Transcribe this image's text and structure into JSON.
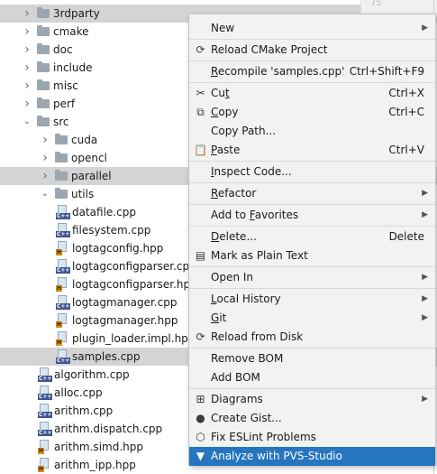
{
  "tree": {
    "scroll_hint": "75",
    "rows": [
      {
        "label": "3rdparty",
        "kind": "folder",
        "expand": "closed"
      },
      {
        "label": "cmake",
        "kind": "folder",
        "expand": "closed"
      },
      {
        "label": "doc",
        "kind": "folder",
        "expand": "closed"
      },
      {
        "label": "include",
        "kind": "folder",
        "expand": "closed"
      },
      {
        "label": "misc",
        "kind": "folder",
        "expand": "closed"
      },
      {
        "label": "perf",
        "kind": "folder",
        "expand": "closed"
      },
      {
        "label": "src",
        "kind": "folder",
        "expand": "open"
      },
      {
        "label": "cuda",
        "kind": "folder",
        "expand": "closed"
      },
      {
        "label": "opencl",
        "kind": "folder",
        "expand": "closed"
      },
      {
        "label": "parallel",
        "kind": "folder",
        "expand": "closed"
      },
      {
        "label": "utils",
        "kind": "folder",
        "expand": "open"
      },
      {
        "label": "datafile.cpp",
        "kind": "cpp",
        "tag": "C++"
      },
      {
        "label": "filesystem.cpp",
        "kind": "cpp",
        "tag": "C++"
      },
      {
        "label": "logtagconfig.hpp",
        "kind": "hpp",
        "tag": "H"
      },
      {
        "label": "logtagconfigparser.cp",
        "kind": "cpp",
        "tag": "C++"
      },
      {
        "label": "logtagconfigparser.hp",
        "kind": "hpp",
        "tag": "H"
      },
      {
        "label": "logtagmanager.cpp",
        "kind": "cpp",
        "tag": "C++"
      },
      {
        "label": "logtagmanager.hpp",
        "kind": "hpp",
        "tag": "H"
      },
      {
        "label": "plugin_loader.impl.hp",
        "kind": "hpp",
        "tag": "H"
      },
      {
        "label": "samples.cpp",
        "kind": "cpp",
        "tag": "C++"
      },
      {
        "label": "algorithm.cpp",
        "kind": "cpp",
        "tag": "C++"
      },
      {
        "label": "alloc.cpp",
        "kind": "cpp",
        "tag": "C++"
      },
      {
        "label": "arithm.cpp",
        "kind": "cpp",
        "tag": "C++"
      },
      {
        "label": "arithm.dispatch.cpp",
        "kind": "cpp",
        "tag": "C++"
      },
      {
        "label": "arithm.simd.hpp",
        "kind": "hpp",
        "tag": "H"
      },
      {
        "label": "arithm_ipp.hpp",
        "kind": "hpp",
        "tag": "H"
      }
    ]
  },
  "menu": {
    "items": [
      {
        "label": "New",
        "submenu": true
      },
      {
        "sep": true
      },
      {
        "label": "Reload CMake Project",
        "icon": "reload-cmake-icon",
        "glyph": "⟳"
      },
      {
        "sep": true
      },
      {
        "label": "Recompile 'samples.cpp'",
        "shortcut": "Ctrl+Shift+F9"
      },
      {
        "sep": true
      },
      {
        "label": "Cut",
        "icon": "cut-icon",
        "glyph": "✂",
        "shortcut": "Ctrl+X"
      },
      {
        "label": "Copy",
        "icon": "copy-icon",
        "glyph": "⧉",
        "shortcut": "Ctrl+C"
      },
      {
        "label": "Copy Path..."
      },
      {
        "label": "Paste",
        "icon": "paste-icon",
        "glyph": "📋",
        "shortcut": "Ctrl+V"
      },
      {
        "sep": true
      },
      {
        "label": "Inspect Code..."
      },
      {
        "sep": true
      },
      {
        "label": "Refactor",
        "submenu": true
      },
      {
        "sep": true
      },
      {
        "label": "Add to Favorites",
        "submenu": true
      },
      {
        "sep": true
      },
      {
        "label": "Delete...",
        "shortcut": "Delete"
      },
      {
        "label": "Mark as Plain Text",
        "icon": "plain-text-icon",
        "glyph": "▤"
      },
      {
        "sep": true
      },
      {
        "label": "Open In",
        "submenu": true
      },
      {
        "sep": true
      },
      {
        "label": "Local History",
        "submenu": true
      },
      {
        "label": "Git",
        "submenu": true
      },
      {
        "label": "Reload from Disk",
        "icon": "reload-disk-icon",
        "glyph": "⟳"
      },
      {
        "sep": true
      },
      {
        "label": "Remove BOM"
      },
      {
        "label": "Add BOM"
      },
      {
        "sep": true
      },
      {
        "label": "Diagrams",
        "icon": "diagrams-icon",
        "glyph": "⊞",
        "submenu": true
      },
      {
        "label": "Create Gist...",
        "icon": "github-icon",
        "glyph": "●"
      },
      {
        "label": "Fix ESLint Problems",
        "icon": "eslint-icon",
        "glyph": "⬡"
      },
      {
        "label": "Analyze with PVS-Studio",
        "icon": "pvs-studio-icon",
        "glyph": "▼",
        "active": true
      }
    ]
  },
  "colors": {
    "selection": "#d4d4d4",
    "menu_active": "#2675bf",
    "menu_bg": "#f2f2f2"
  }
}
